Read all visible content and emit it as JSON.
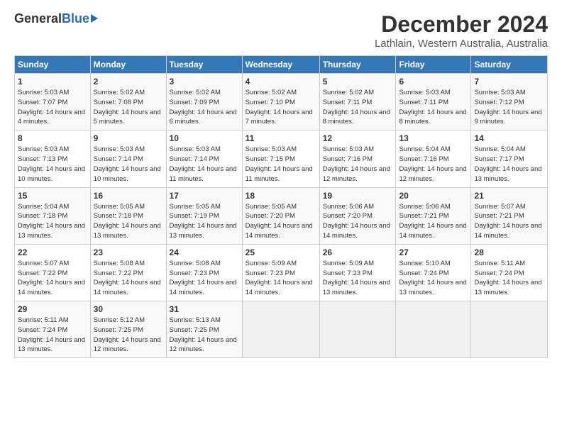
{
  "header": {
    "logo_general": "General",
    "logo_blue": "Blue",
    "title": "December 2024",
    "location": "Lathlain, Western Australia, Australia"
  },
  "calendar": {
    "days_of_week": [
      "Sunday",
      "Monday",
      "Tuesday",
      "Wednesday",
      "Thursday",
      "Friday",
      "Saturday"
    ],
    "weeks": [
      [
        {
          "day": "",
          "empty": true
        },
        {
          "day": "",
          "empty": true
        },
        {
          "day": "",
          "empty": true
        },
        {
          "day": "",
          "empty": true
        },
        {
          "day": "",
          "empty": true
        },
        {
          "day": "",
          "empty": true
        },
        {
          "day": "7",
          "sunrise": "5:03 AM",
          "sunset": "7:12 PM",
          "daylight": "14 hours and 9 minutes."
        }
      ],
      [
        {
          "day": "1",
          "sunrise": "5:03 AM",
          "sunset": "7:07 PM",
          "daylight": "14 hours and 4 minutes."
        },
        {
          "day": "2",
          "sunrise": "5:02 AM",
          "sunset": "7:08 PM",
          "daylight": "14 hours and 5 minutes."
        },
        {
          "day": "3",
          "sunrise": "5:02 AM",
          "sunset": "7:09 PM",
          "daylight": "14 hours and 6 minutes."
        },
        {
          "day": "4",
          "sunrise": "5:02 AM",
          "sunset": "7:10 PM",
          "daylight": "14 hours and 7 minutes."
        },
        {
          "day": "5",
          "sunrise": "5:02 AM",
          "sunset": "7:11 PM",
          "daylight": "14 hours and 8 minutes."
        },
        {
          "day": "6",
          "sunrise": "5:03 AM",
          "sunset": "7:11 PM",
          "daylight": "14 hours and 8 minutes."
        },
        {
          "day": "7",
          "sunrise": "5:03 AM",
          "sunset": "7:12 PM",
          "daylight": "14 hours and 9 minutes."
        }
      ],
      [
        {
          "day": "8",
          "sunrise": "5:03 AM",
          "sunset": "7:13 PM",
          "daylight": "14 hours and 10 minutes."
        },
        {
          "day": "9",
          "sunrise": "5:03 AM",
          "sunset": "7:14 PM",
          "daylight": "14 hours and 10 minutes."
        },
        {
          "day": "10",
          "sunrise": "5:03 AM",
          "sunset": "7:14 PM",
          "daylight": "14 hours and 11 minutes."
        },
        {
          "day": "11",
          "sunrise": "5:03 AM",
          "sunset": "7:15 PM",
          "daylight": "14 hours and 11 minutes."
        },
        {
          "day": "12",
          "sunrise": "5:03 AM",
          "sunset": "7:16 PM",
          "daylight": "14 hours and 12 minutes."
        },
        {
          "day": "13",
          "sunrise": "5:04 AM",
          "sunset": "7:16 PM",
          "daylight": "14 hours and 12 minutes."
        },
        {
          "day": "14",
          "sunrise": "5:04 AM",
          "sunset": "7:17 PM",
          "daylight": "14 hours and 13 minutes."
        }
      ],
      [
        {
          "day": "15",
          "sunrise": "5:04 AM",
          "sunset": "7:18 PM",
          "daylight": "14 hours and 13 minutes."
        },
        {
          "day": "16",
          "sunrise": "5:05 AM",
          "sunset": "7:18 PM",
          "daylight": "14 hours and 13 minutes."
        },
        {
          "day": "17",
          "sunrise": "5:05 AM",
          "sunset": "7:19 PM",
          "daylight": "14 hours and 13 minutes."
        },
        {
          "day": "18",
          "sunrise": "5:05 AM",
          "sunset": "7:20 PM",
          "daylight": "14 hours and 14 minutes."
        },
        {
          "day": "19",
          "sunrise": "5:06 AM",
          "sunset": "7:20 PM",
          "daylight": "14 hours and 14 minutes."
        },
        {
          "day": "20",
          "sunrise": "5:06 AM",
          "sunset": "7:21 PM",
          "daylight": "14 hours and 14 minutes."
        },
        {
          "day": "21",
          "sunrise": "5:07 AM",
          "sunset": "7:21 PM",
          "daylight": "14 hours and 14 minutes."
        }
      ],
      [
        {
          "day": "22",
          "sunrise": "5:07 AM",
          "sunset": "7:22 PM",
          "daylight": "14 hours and 14 minutes."
        },
        {
          "day": "23",
          "sunrise": "5:08 AM",
          "sunset": "7:22 PM",
          "daylight": "14 hours and 14 minutes."
        },
        {
          "day": "24",
          "sunrise": "5:08 AM",
          "sunset": "7:23 PM",
          "daylight": "14 hours and 14 minutes."
        },
        {
          "day": "25",
          "sunrise": "5:09 AM",
          "sunset": "7:23 PM",
          "daylight": "14 hours and 14 minutes."
        },
        {
          "day": "26",
          "sunrise": "5:09 AM",
          "sunset": "7:23 PM",
          "daylight": "14 hours and 13 minutes."
        },
        {
          "day": "27",
          "sunrise": "5:10 AM",
          "sunset": "7:24 PM",
          "daylight": "14 hours and 13 minutes."
        },
        {
          "day": "28",
          "sunrise": "5:11 AM",
          "sunset": "7:24 PM",
          "daylight": "14 hours and 13 minutes."
        }
      ],
      [
        {
          "day": "29",
          "sunrise": "5:11 AM",
          "sunset": "7:24 PM",
          "daylight": "14 hours and 13 minutes."
        },
        {
          "day": "30",
          "sunrise": "5:12 AM",
          "sunset": "7:25 PM",
          "daylight": "14 hours and 12 minutes."
        },
        {
          "day": "31",
          "sunrise": "5:13 AM",
          "sunset": "7:25 PM",
          "daylight": "14 hours and 12 minutes."
        },
        {
          "day": "",
          "empty": true
        },
        {
          "day": "",
          "empty": true
        },
        {
          "day": "",
          "empty": true
        },
        {
          "day": "",
          "empty": true
        }
      ]
    ]
  }
}
